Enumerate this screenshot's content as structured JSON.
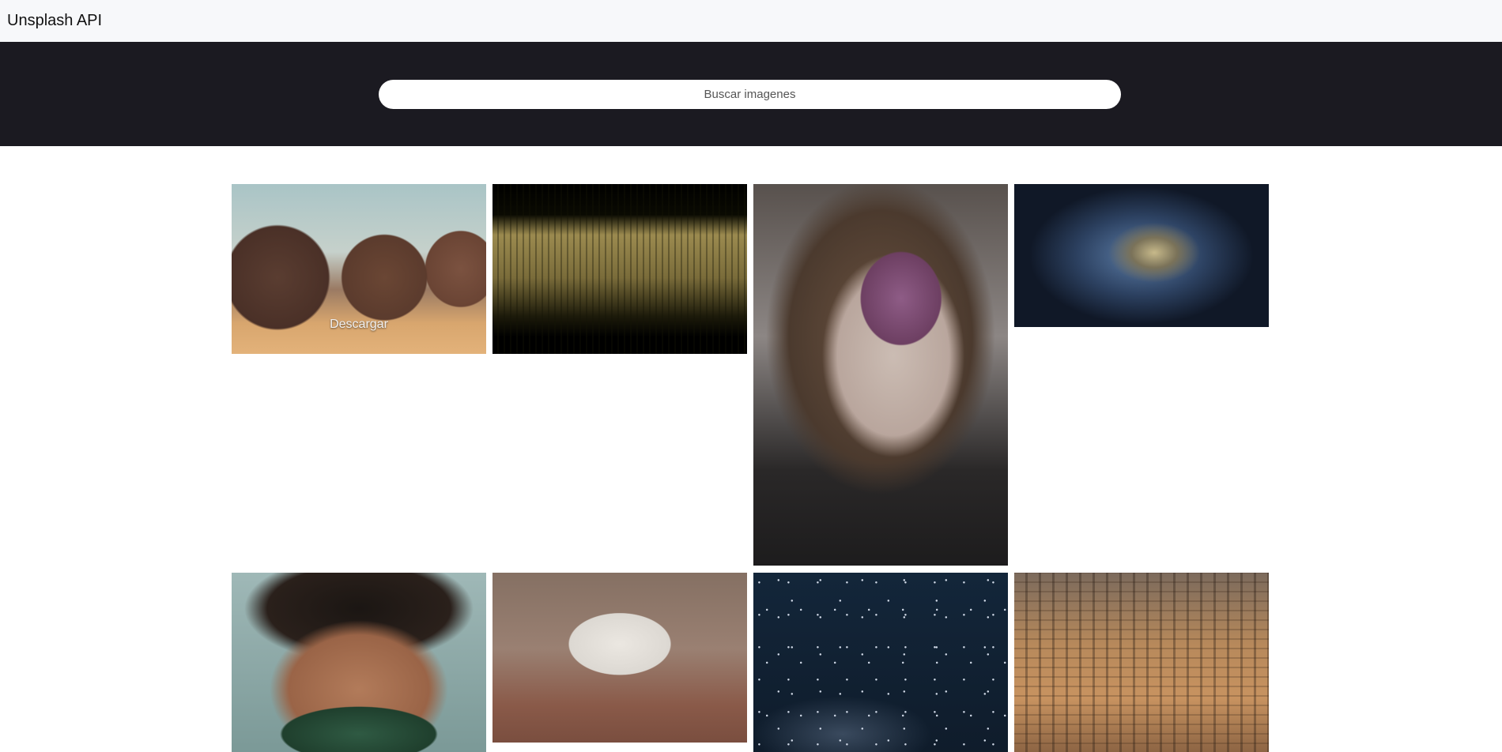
{
  "navbar": {
    "brand": "Unsplash API"
  },
  "search": {
    "placeholder": "Buscar imagenes",
    "value": ""
  },
  "gallery": {
    "download_label": "Descargar",
    "images": [
      {
        "name": "desert-rocks-photo"
      },
      {
        "name": "golden-grass-photo"
      },
      {
        "name": "man-with-flower-photo"
      },
      {
        "name": "abstract-swirl-photo"
      },
      {
        "name": "curly-hair-glasses-photo"
      },
      {
        "name": "wall-tiles-photo"
      },
      {
        "name": "starry-sky-photo"
      },
      {
        "name": "city-buildings-photo"
      }
    ]
  }
}
